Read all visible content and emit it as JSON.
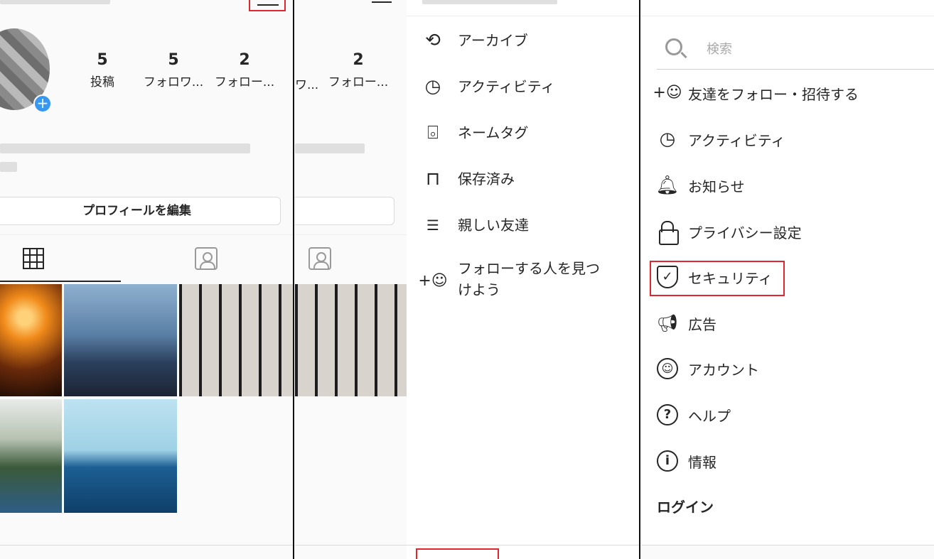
{
  "profile": {
    "stats": [
      {
        "num": "5",
        "label": "投稿"
      },
      {
        "num": "5",
        "label": "フォロワ..."
      },
      {
        "num": "2",
        "label": "フォロー..."
      }
    ],
    "edit_label": "プロフィールを編集"
  },
  "profile_partial": {
    "stat_num": "2",
    "stat_label": "フォロー...",
    "left_label": "ワ..."
  },
  "menu": {
    "items": [
      {
        "icon": "archive-icon",
        "label": "アーカイブ"
      },
      {
        "icon": "activity-icon",
        "label": "アクティビティ"
      },
      {
        "icon": "nametag-icon",
        "label": "ネームタグ"
      },
      {
        "icon": "bookmark-icon",
        "label": "保存済み"
      },
      {
        "icon": "close-friends-icon",
        "label": "親しい友達"
      },
      {
        "icon": "discover-people-icon",
        "label_line1": "フォローする人を見つ",
        "label_line2": "けよう"
      }
    ]
  },
  "settings": {
    "search_placeholder": "検索",
    "items": [
      {
        "icon": "add-person-icon",
        "label": "友達をフォロー・招待する"
      },
      {
        "icon": "activity-icon",
        "label": "アクティビティ"
      },
      {
        "icon": "bell-icon",
        "label": "お知らせ"
      },
      {
        "icon": "lock-icon",
        "label": "プライバシー設定"
      },
      {
        "icon": "shield-check-icon",
        "label": "セキュリティ"
      },
      {
        "icon": "megaphone-icon",
        "label": "広告"
      },
      {
        "icon": "account-icon",
        "label": "アカウント"
      },
      {
        "icon": "help-icon",
        "label": "ヘルプ"
      },
      {
        "icon": "info-icon",
        "label": "情報"
      }
    ],
    "login_label": "ログイン"
  },
  "colors": {
    "highlight": "#e0262e",
    "badge": "#3897f0",
    "text": "#262626"
  }
}
